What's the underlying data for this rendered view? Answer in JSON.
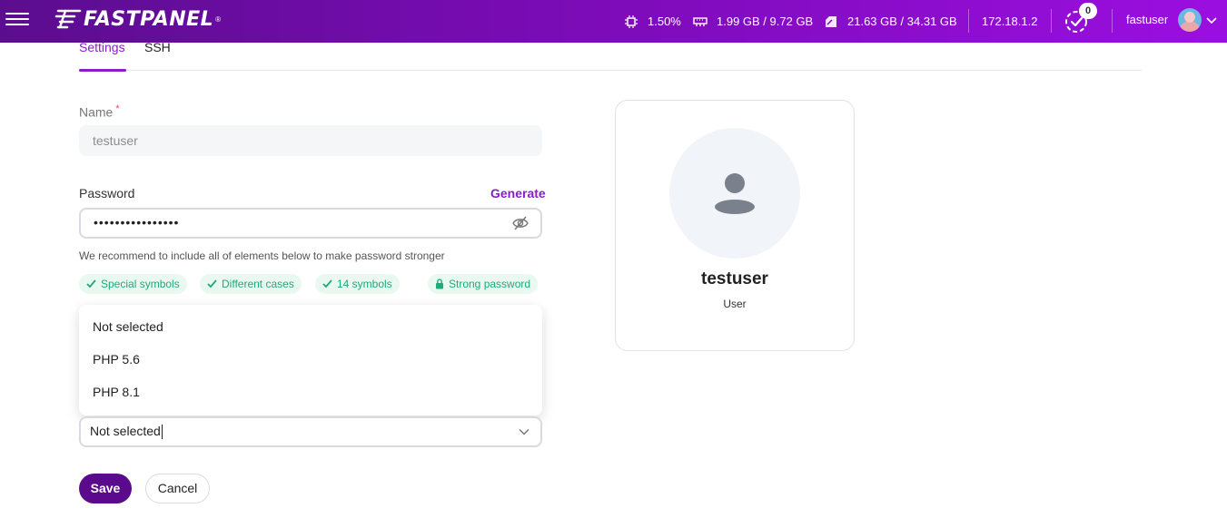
{
  "header": {
    "logo_text": "FASTPANEL",
    "logo_mark": "®",
    "cpu": "1.50%",
    "memory": "1.99 GB / 9.72 GB",
    "disk": "21.63 GB / 34.31 GB",
    "ip": "172.18.1.2",
    "tasks_count": "0",
    "username": "fastuser",
    "accent_color": "#8a1dc9"
  },
  "tabs": [
    {
      "label": "Settings",
      "active": true
    },
    {
      "label": "SSH",
      "active": false
    }
  ],
  "form": {
    "name_label": "Name",
    "name_required_mark": "*",
    "name_value": "testuser",
    "password_label": "Password",
    "generate_label": "Generate",
    "password_value": "••••••••••••••••",
    "password_hint": "We recommend to include all of elements below to make password stronger",
    "checks": [
      {
        "label": "Special symbols",
        "icon": "check-icon"
      },
      {
        "label": "Different cases",
        "icon": "check-icon"
      },
      {
        "label": "14 symbols",
        "icon": "check-icon"
      },
      {
        "label": "Strong password",
        "icon": "lock-icon"
      }
    ],
    "php_options": [
      "Not selected",
      "PHP 5.6",
      "PHP 8.1"
    ],
    "php_selected": "Not selected",
    "save_label": "Save",
    "cancel_label": "Cancel"
  },
  "card": {
    "name": "testuser",
    "role": "User"
  }
}
